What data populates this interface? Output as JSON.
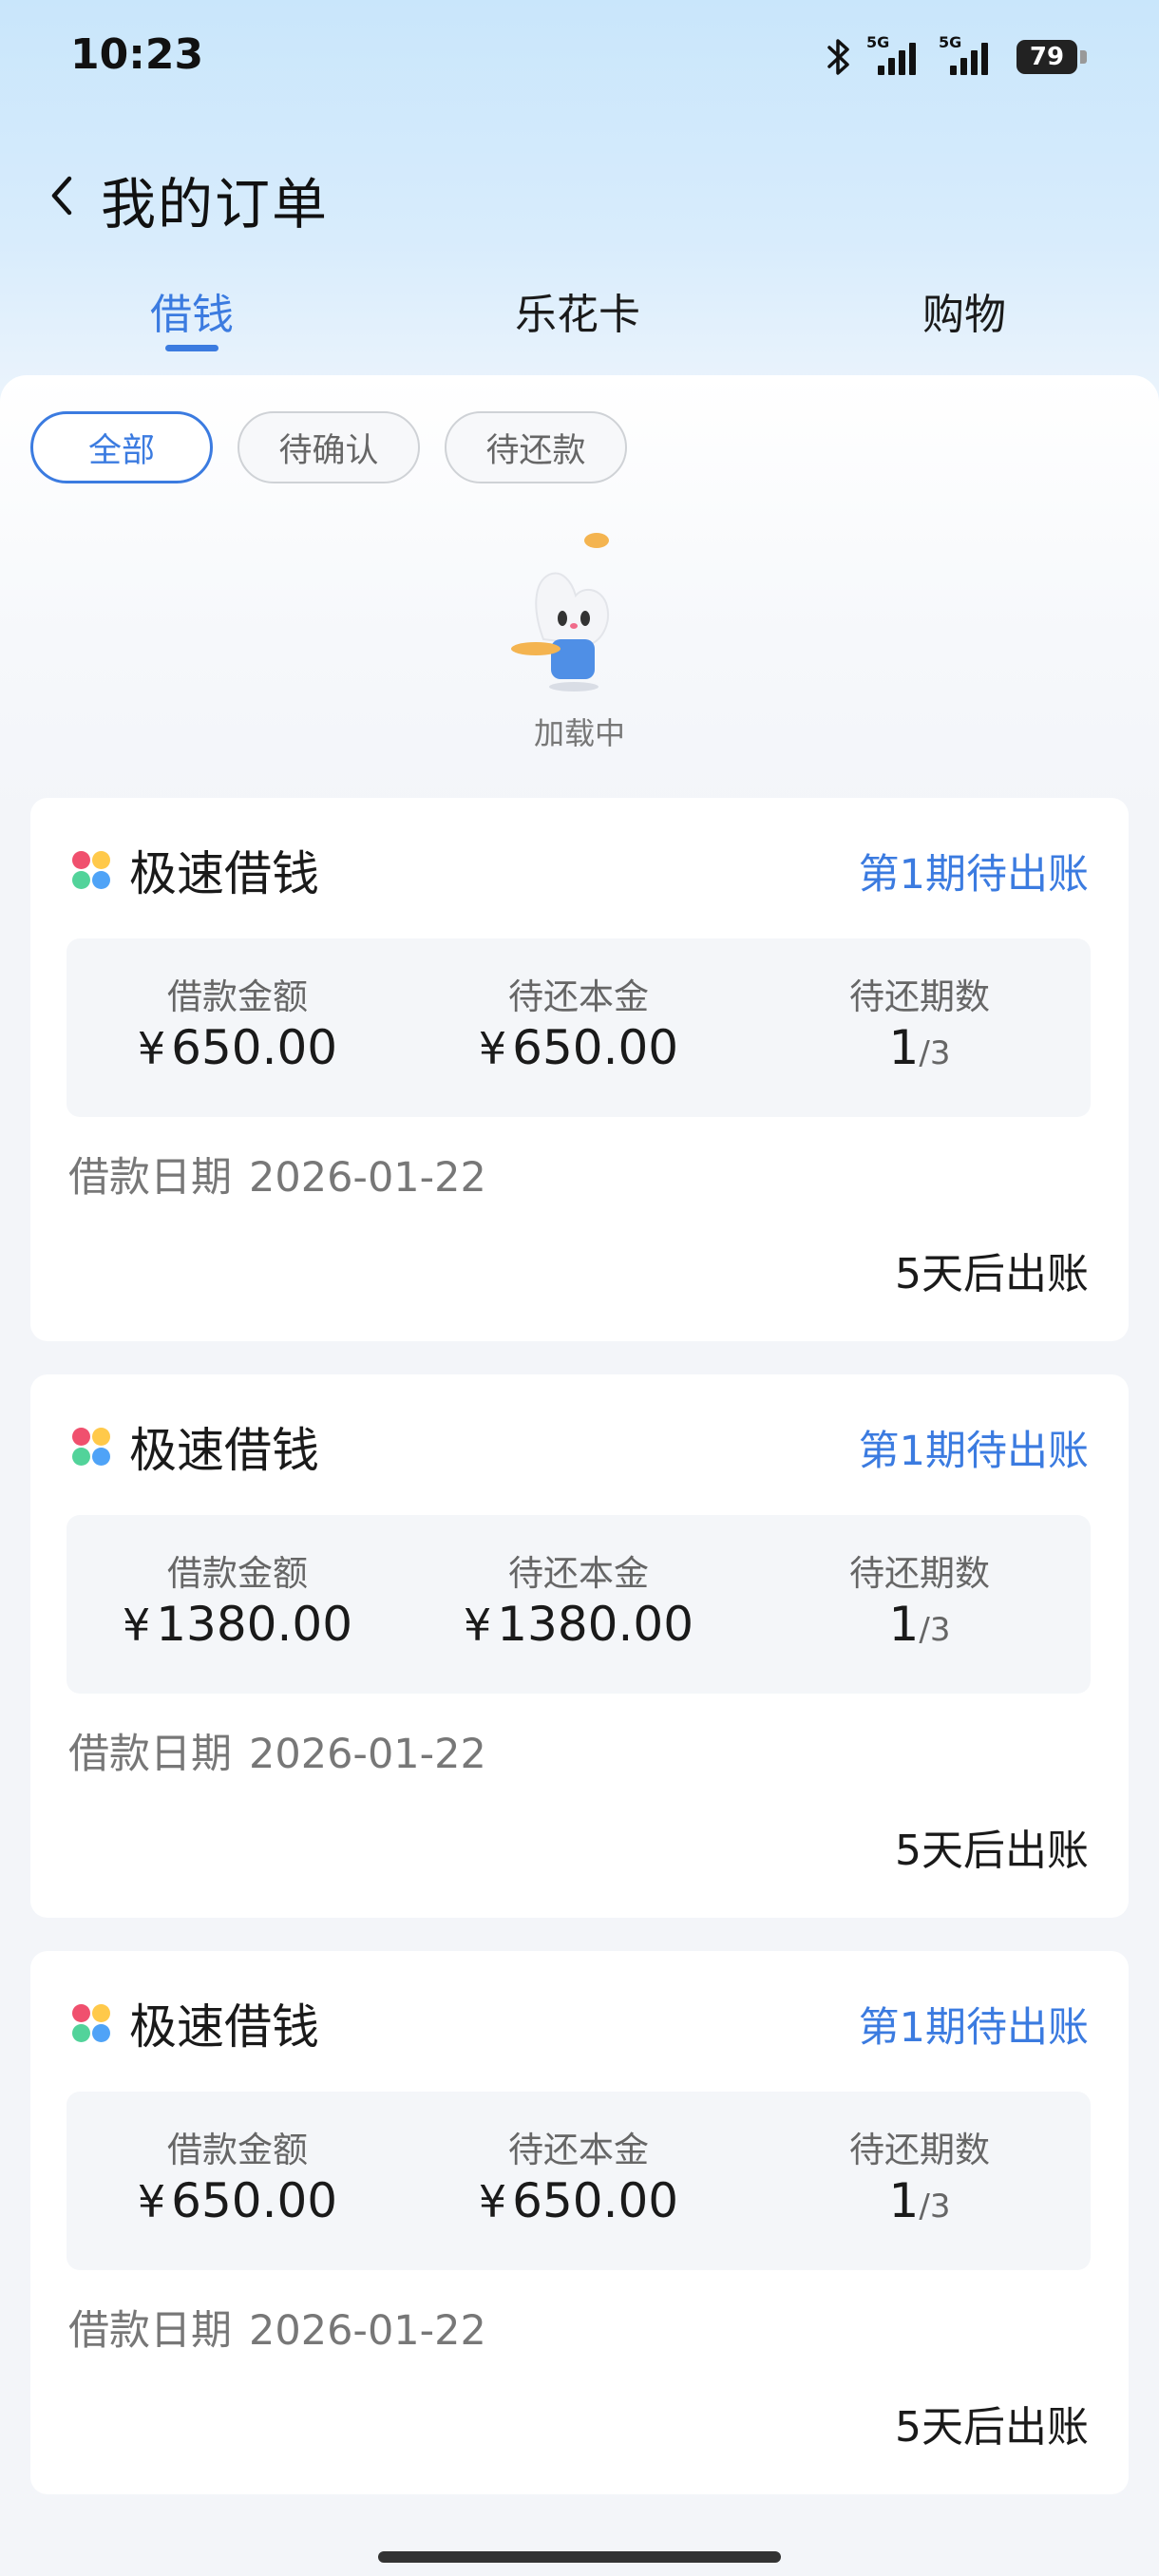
{
  "status_bar": {
    "time": "10:23",
    "network_1": "5G",
    "network_2": "5G",
    "battery": "79"
  },
  "header": {
    "title": "我的订单"
  },
  "tabs": [
    {
      "label": "借钱",
      "active": true
    },
    {
      "label": "乐花卡",
      "active": false
    },
    {
      "label": "购物",
      "active": false
    }
  ],
  "filters": [
    {
      "label": "全部",
      "active": true
    },
    {
      "label": "待确认",
      "active": false
    },
    {
      "label": "待还款",
      "active": false
    }
  ],
  "loading": {
    "text": "加载中"
  },
  "labels": {
    "loan_amount": "借款金额",
    "remaining_principal": "待还本金",
    "remaining_periods": "待还期数",
    "loan_date": "借款日期",
    "currency": "¥"
  },
  "orders": [
    {
      "product": "极速借钱",
      "status": "第1期待出账",
      "loan_amount": "650.00",
      "remaining_principal": "650.00",
      "remaining_periods": "1",
      "total_periods": "/3",
      "loan_date": "2026-01-22",
      "due_text": "5天后出账"
    },
    {
      "product": "极速借钱",
      "status": "第1期待出账",
      "loan_amount": "1380.00",
      "remaining_principal": "1380.00",
      "remaining_periods": "1",
      "total_periods": "/3",
      "loan_date": "2026-01-22",
      "due_text": "5天后出账"
    },
    {
      "product": "极速借钱",
      "status": "第1期待出账",
      "loan_amount": "650.00",
      "remaining_principal": "650.00",
      "remaining_periods": "1",
      "total_periods": "/3",
      "loan_date": "2026-01-22",
      "due_text": "5天后出账"
    }
  ],
  "colors": {
    "accent": "#3b7be0",
    "icon_red": "#f0506e",
    "icon_yellow": "#ffc94a",
    "icon_blue": "#4fa3f7",
    "icon_green": "#52d39a"
  },
  "icons": {
    "back": "chevron-left-icon",
    "bluetooth": "bluetooth-icon",
    "product": "four-dots-logo-icon",
    "mascot": "mascot-illustration"
  }
}
